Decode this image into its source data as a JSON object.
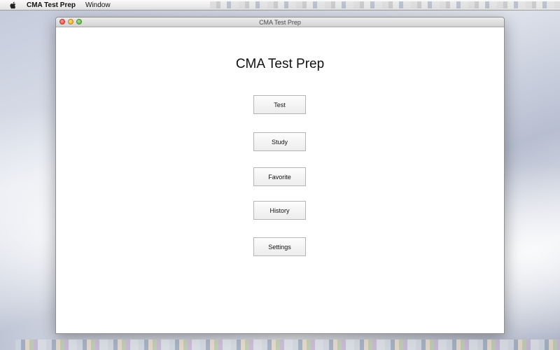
{
  "menubar": {
    "app_name": "CMA Test Prep",
    "items": [
      "Window"
    ]
  },
  "window": {
    "title": "CMA Test Prep"
  },
  "main": {
    "heading": "CMA Test Prep",
    "buttons": [
      {
        "label": "Test"
      },
      {
        "label": "Study"
      },
      {
        "label": "Favorite"
      },
      {
        "label": "History"
      },
      {
        "label": "Settings"
      }
    ]
  }
}
